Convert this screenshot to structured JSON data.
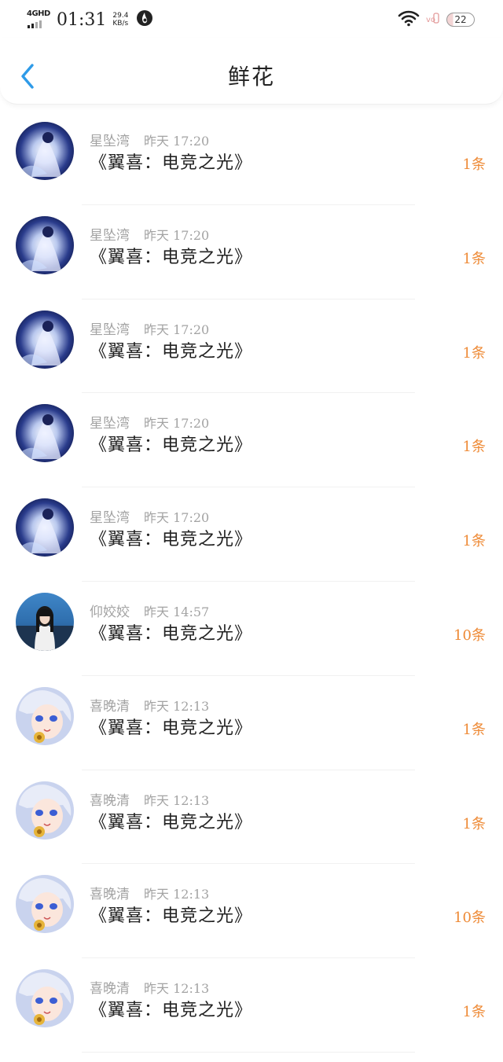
{
  "status_bar": {
    "network": "4GHD",
    "time": "01:31",
    "speed_value": "29.4",
    "speed_unit": "KB/s",
    "battery": "22"
  },
  "header": {
    "title": "鲜花"
  },
  "items": [
    {
      "user": "星坠湾",
      "time": "昨天 17:20",
      "work": "《翼喜：电竞之光》",
      "count": "1条",
      "avatar": "star-avatar"
    },
    {
      "user": "星坠湾",
      "time": "昨天 17:20",
      "work": "《翼喜：电竞之光》",
      "count": "1条",
      "avatar": "star-avatar"
    },
    {
      "user": "星坠湾",
      "time": "昨天 17:20",
      "work": "《翼喜：电竞之光》",
      "count": "1条",
      "avatar": "star-avatar"
    },
    {
      "user": "星坠湾",
      "time": "昨天 17:20",
      "work": "《翼喜：电竞之光》",
      "count": "1条",
      "avatar": "star-avatar"
    },
    {
      "user": "星坠湾",
      "time": "昨天 17:20",
      "work": "《翼喜：电竞之光》",
      "count": "1条",
      "avatar": "star-avatar"
    },
    {
      "user": "仰姣姣",
      "time": "昨天 14:57",
      "work": "《翼喜：电竞之光》",
      "count": "10条",
      "avatar": "girl-avatar"
    },
    {
      "user": "喜晚清",
      "time": "昨天 12:13",
      "work": "《翼喜：电竞之光》",
      "count": "1条",
      "avatar": "anime-avatar"
    },
    {
      "user": "喜晚清",
      "time": "昨天 12:13",
      "work": "《翼喜：电竞之光》",
      "count": "1条",
      "avatar": "anime-avatar"
    },
    {
      "user": "喜晚清",
      "time": "昨天 12:13",
      "work": "《翼喜：电竞之光》",
      "count": "10条",
      "avatar": "anime-avatar"
    },
    {
      "user": "喜晚清",
      "time": "昨天 12:13",
      "work": "《翼喜：电竞之光》",
      "count": "1条",
      "avatar": "anime-avatar"
    }
  ],
  "colors": {
    "accent": "#2f9be8",
    "count": "#ee8a36",
    "meta": "#a3a3a3"
  }
}
